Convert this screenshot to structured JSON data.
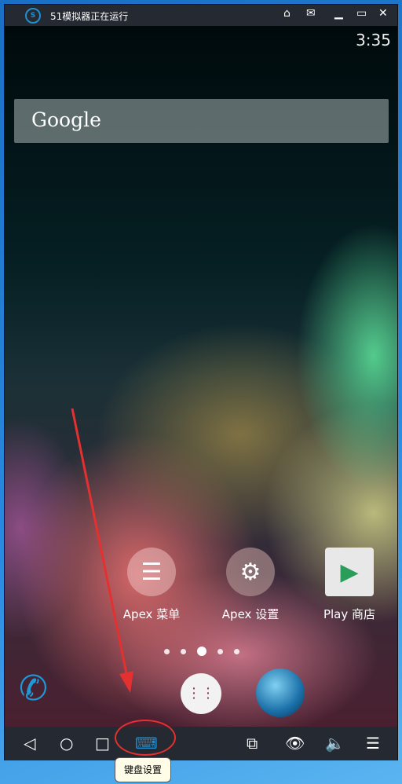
{
  "window": {
    "title": "51模拟器正在运行",
    "logo": "51"
  },
  "status": {
    "time": "3:35"
  },
  "search": {
    "label": "Google"
  },
  "apps": [
    {
      "label": "Apex 菜单",
      "icon": "menu-icon"
    },
    {
      "label": "Apex 设置",
      "icon": "gear-icon"
    },
    {
      "label": "Play 商店",
      "icon": "play-store-icon"
    }
  ],
  "pages": {
    "count": 5,
    "current": 3
  },
  "dock": [
    {
      "icon": "phone-icon"
    },
    {
      "icon": "app-drawer-icon"
    },
    {
      "icon": "browser-globe-icon"
    }
  ],
  "tooltip": "键盘设置",
  "colors": {
    "accent": "#1f8fd0",
    "annotation": "#e53030"
  }
}
